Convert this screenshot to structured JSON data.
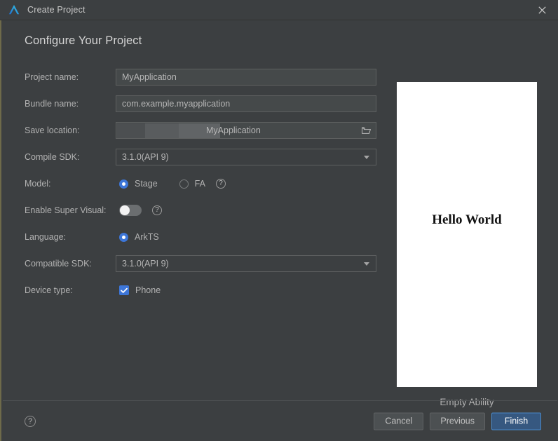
{
  "titlebar": {
    "title": "Create Project",
    "logo_icon": "deveco-logo-icon",
    "close_icon": "close-icon"
  },
  "dialog": {
    "heading": "Configure Your Project"
  },
  "form": {
    "project_name": {
      "label": "Project name:",
      "value": "MyApplication"
    },
    "bundle_name": {
      "label": "Bundle name:",
      "value": "com.example.myapplication"
    },
    "save_location": {
      "label": "Save location:",
      "value": "MyApplication",
      "browse_icon": "folder-icon"
    },
    "compile_sdk": {
      "label": "Compile SDK:",
      "value": "3.1.0(API 9)",
      "dropdown_icon": "chevron-down-icon"
    },
    "model": {
      "label": "Model:",
      "options": [
        {
          "label": "Stage",
          "selected": true
        },
        {
          "label": "FA",
          "selected": false
        }
      ],
      "help_icon": "help-circle-icon",
      "help_glyph": "?"
    },
    "enable_super_visual": {
      "label": "Enable Super Visual:",
      "state": "off",
      "help_icon": "help-circle-icon",
      "help_glyph": "?"
    },
    "language": {
      "label": "Language:",
      "options": [
        {
          "label": "ArkTS",
          "selected": true
        }
      ]
    },
    "compatible_sdk": {
      "label": "Compatible SDK:",
      "value": "3.1.0(API 9)",
      "dropdown_icon": "chevron-down-icon"
    },
    "device_type": {
      "label": "Device type:",
      "options": [
        {
          "label": "Phone",
          "checked": true
        }
      ]
    }
  },
  "preview": {
    "screen_text": "Hello World",
    "caption": "Empty Ability"
  },
  "footer": {
    "help_icon": "help-circle-icon",
    "help_glyph": "?",
    "cancel_label": "Cancel",
    "previous_label": "Previous",
    "finish_label": "Finish"
  },
  "colors": {
    "accent": "#3d76d8",
    "primary_button": "#365880",
    "dialog_bg": "#3c3f41",
    "field_bg": "#45494a"
  }
}
